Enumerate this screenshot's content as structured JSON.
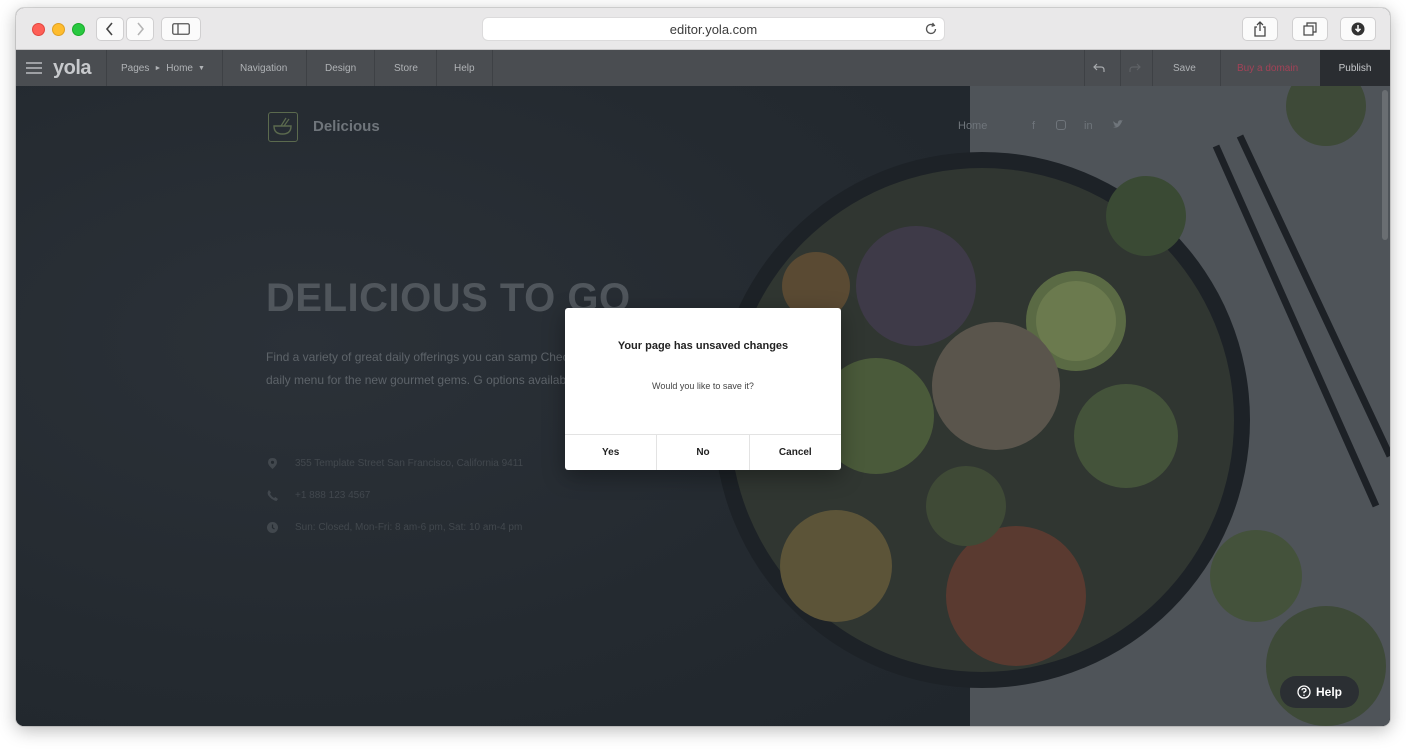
{
  "browser": {
    "url": "editor.yola.com"
  },
  "toolbar": {
    "logo": "yola",
    "pages_label": "Pages",
    "current_page": "Home",
    "menu": [
      "Navigation",
      "Design",
      "Store",
      "Help"
    ],
    "save_label": "Save",
    "buy_domain_label": "Buy a domain",
    "publish_label": "Publish"
  },
  "site": {
    "name": "Delicious",
    "nav_home": "Home",
    "social": [
      "f",
      "in"
    ],
    "hero_title": "DELICIOUS TO GO",
    "hero_text": "Find a variety of great daily offerings you can samp Check the daily menu for the new gourmet gems. G options available.",
    "address": "355 Template Street San Francisco, California 9411",
    "phone": "+1 888 123 4567",
    "hours": "Sun: Closed, Mon-Fri: 8 am-6 pm, Sat: 10 am-4 pm"
  },
  "dialog": {
    "title": "Your page has unsaved changes",
    "message": "Would you like to save it?",
    "yes_label": "Yes",
    "no_label": "No",
    "cancel_label": "Cancel"
  },
  "help_button": {
    "label": "Help"
  },
  "colors": {
    "toolbar_bg": "#4a4d51",
    "publish_bg": "#2a2d31",
    "buy_domain": "#a34257",
    "dialog_bg": "#ffffff"
  }
}
